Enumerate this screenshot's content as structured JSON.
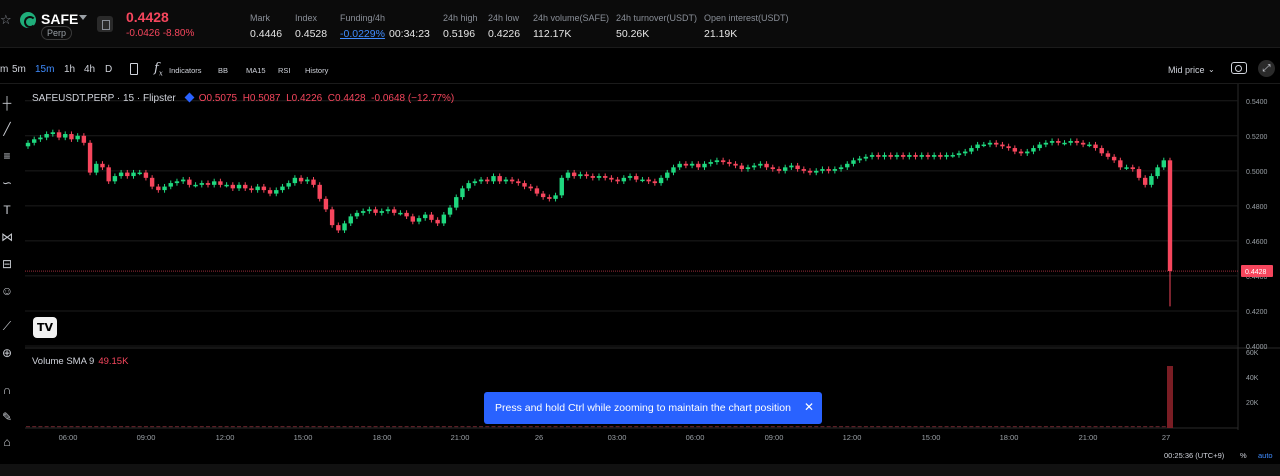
{
  "ticker": {
    "symbol": "SAFE",
    "badge": "Perp",
    "last_price": "0.4428",
    "change": "-0.0426 -8.80%",
    "stats": [
      {
        "label": "Mark",
        "value": "0.4446"
      },
      {
        "label": "Index",
        "value": "0.4528"
      },
      {
        "label": "Funding/4h",
        "value": "-0.0229%",
        "extra": "00:34:23"
      },
      {
        "label": "24h high",
        "value": "0.5196"
      },
      {
        "label": "24h low",
        "value": "0.4226"
      },
      {
        "label": "24h volume(SAFE)",
        "value": "112.17K"
      },
      {
        "label": "24h turnover(USDT)",
        "value": "50.26K"
      },
      {
        "label": "Open interest(USDT)",
        "value": "21.19K"
      }
    ]
  },
  "toolbar": {
    "intervals": [
      "m",
      "5m",
      "15m",
      "1h",
      "4h",
      "D"
    ],
    "active_interval": "15m",
    "indicators_label": "Indicators",
    "studies": [
      "BB",
      "MA15",
      "RSI",
      "History"
    ],
    "price_mode": "Mid price"
  },
  "legend": {
    "title": "SAFEUSDT.PERP · 15 · Flipster",
    "open": "O0.5075",
    "high": "H0.5087",
    "low": "L0.4226",
    "close": "C0.4428",
    "delta": "-0.0648 (−12.77%)"
  },
  "volume_legend": {
    "label": "Volume SMA 9",
    "value": "49.15K"
  },
  "tv_logo": "TV",
  "toast": {
    "text": "Press and hold Ctrl while zooming to maintain the chart position",
    "close": "✕"
  },
  "status": {
    "clock": "00:25:36 (UTC+9)",
    "percent": "%",
    "auto": "auto"
  },
  "colors": {
    "up": "#26a69a",
    "up_bright": "#1fd87f",
    "down": "#f6465d",
    "accent": "#2962ff",
    "link": "#3f8cff"
  },
  "icons": [
    "star-icon",
    "coin-icon",
    "chevron-down-icon",
    "document-icon",
    "candles-icon",
    "function-icon",
    "camera-icon",
    "fullscreen-icon",
    "crosshair-icon",
    "trend-line-icon",
    "fib-icon",
    "brush-icon",
    "text-icon",
    "pattern-icon",
    "measure-icon",
    "emoji-icon",
    "ruler-icon",
    "zoom-icon",
    "magnet-icon",
    "lock-icon",
    "trash-icon"
  ],
  "chart_data": {
    "type": "candlestick",
    "title": "SAFEUSDT.PERP · 15 · Flipster",
    "y_axis_ticks": [
      0.54,
      0.52,
      0.5,
      0.48,
      0.46,
      0.44,
      0.42,
      0.4
    ],
    "y_axis_labels": [
      "0.5400",
      "0.5200",
      "0.5000",
      "0.4800",
      "0.4600",
      "0.4400",
      "0.4200",
      "0.4000"
    ],
    "ylim": [
      0.4,
      0.545
    ],
    "last_price_label": "0.4428",
    "volume_ticks": [
      "60K",
      "40K",
      "20K"
    ],
    "x_axis_labels": [
      "06:00",
      "09:00",
      "12:00",
      "15:00",
      "18:00",
      "21:00",
      "26",
      "03:00",
      "06:00",
      "09:00",
      "12:00",
      "15:00",
      "18:00",
      "21:00",
      "27"
    ],
    "closes": [
      0.516,
      0.518,
      0.519,
      0.521,
      0.522,
      0.519,
      0.521,
      0.518,
      0.52,
      0.516,
      0.499,
      0.504,
      0.502,
      0.494,
      0.497,
      0.499,
      0.497,
      0.499,
      0.499,
      0.496,
      0.491,
      0.489,
      0.491,
      0.493,
      0.494,
      0.495,
      0.492,
      0.492,
      0.493,
      0.492,
      0.494,
      0.492,
      0.492,
      0.49,
      0.492,
      0.49,
      0.489,
      0.491,
      0.489,
      0.487,
      0.489,
      0.491,
      0.493,
      0.496,
      0.494,
      0.495,
      0.492,
      0.484,
      0.478,
      0.469,
      0.466,
      0.47,
      0.474,
      0.476,
      0.477,
      0.478,
      0.476,
      0.477,
      0.478,
      0.476,
      0.476,
      0.474,
      0.471,
      0.473,
      0.475,
      0.472,
      0.47,
      0.475,
      0.479,
      0.485,
      0.49,
      0.493,
      0.494,
      0.495,
      0.494,
      0.497,
      0.494,
      0.495,
      0.494,
      0.493,
      0.491,
      0.49,
      0.487,
      0.485,
      0.484,
      0.486,
      0.496,
      0.499,
      0.497,
      0.498,
      0.497,
      0.496,
      0.497,
      0.496,
      0.495,
      0.494,
      0.496,
      0.497,
      0.495,
      0.495,
      0.494,
      0.493,
      0.496,
      0.499,
      0.502,
      0.504,
      0.503,
      0.504,
      0.502,
      0.504,
      0.505,
      0.506,
      0.505,
      0.504,
      0.503,
      0.501,
      0.502,
      0.503,
      0.504,
      0.502,
      0.501,
      0.5,
      0.502,
      0.503,
      0.501,
      0.5,
      0.499,
      0.5,
      0.501,
      0.5,
      0.501,
      0.502,
      0.504,
      0.506,
      0.507,
      0.508,
      0.509,
      0.508,
      0.509,
      0.508,
      0.509,
      0.508,
      0.509,
      0.508,
      0.509,
      0.508,
      0.509,
      0.508,
      0.509,
      0.509,
      0.51,
      0.511,
      0.513,
      0.515,
      0.515,
      0.516,
      0.515,
      0.514,
      0.513,
      0.511,
      0.51,
      0.511,
      0.513,
      0.515,
      0.516,
      0.517,
      0.516,
      0.516,
      0.517,
      0.516,
      0.515,
      0.515,
      0.513,
      0.51,
      0.508,
      0.506,
      0.502,
      0.502,
      0.501,
      0.496,
      0.492,
      0.497,
      0.502,
      0.506,
      0.4428
    ],
    "volume_spike": "last candle ~53K"
  }
}
